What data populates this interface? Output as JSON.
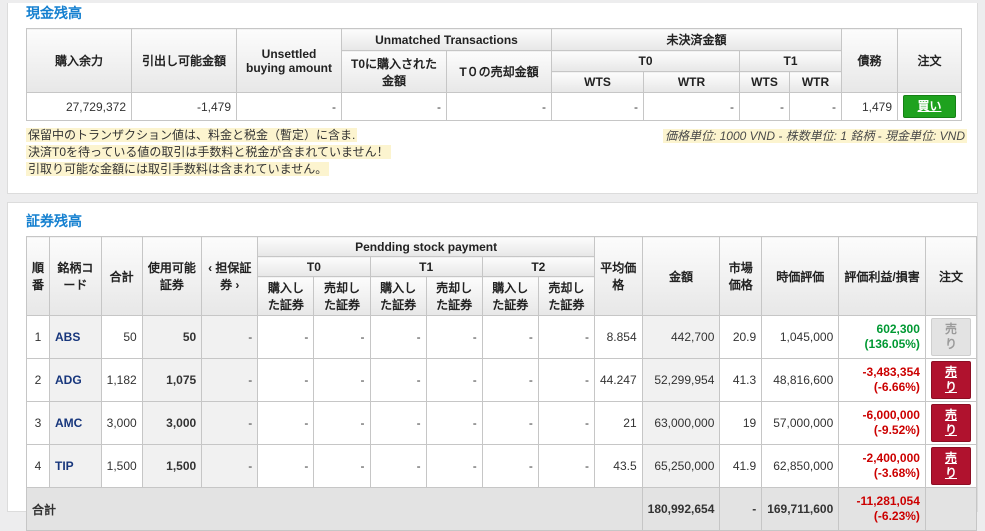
{
  "units_note": "価格単位: 1000 VND - 株数単位: 1 銘柄 - 現金単位: VND",
  "colors": {
    "accent_blue": "#1580d0",
    "buy_green": "#1ea21e",
    "sell_red": "#b0122e",
    "gain_green": "#009933",
    "loss_red": "#cc0000",
    "note_highlight": "#fcf4cf"
  },
  "cash": {
    "title": "現金残高",
    "headers": {
      "buying_power": "購入余力",
      "withdrawable": "引出し可能金額",
      "unsettled_buying": "Unsettled buying amount",
      "unmatched": "Unmatched Transactions",
      "t0_bought": "T0に購入された金額",
      "t0_sold": "T０の売却金額",
      "outstanding": "未決済金額",
      "t0": "T0",
      "t1": "T1",
      "wts": "WTS",
      "wtr": "WTR",
      "debt": "債務",
      "order": "注文"
    },
    "row": {
      "buying_power": "27,729,372",
      "withdrawable": "-1,479",
      "unsettled_buying": "-",
      "t0_bought": "-",
      "t0_sold": "-",
      "t0_wts": "-",
      "t0_wtr": "-",
      "t1_wts": "-",
      "t1_wtr": "-",
      "debt": "1,479",
      "buy_label": "買い"
    },
    "notes": [
      "保留中のトランザクション値は、料金と税金（暫定）に含ま.",
      "決済T0を待っている値の取引は手数料と税金が含まれていません！",
      "引取り可能な金額には取引手数料は含まれていません。"
    ]
  },
  "stock": {
    "title": "証券残高",
    "headers": {
      "no": "順番",
      "code": "銘柄コード",
      "total": "合計",
      "available": "使用可能証券",
      "collateral": "‹ 担保証券 ›",
      "pending": "Pendding stock payment",
      "t0": "T0",
      "t1": "T1",
      "t2": "T2",
      "bought": "購入した証券",
      "sold": "売却した証券",
      "avg_price": "平均価格",
      "amount": "金額",
      "market_price": "市場価格",
      "market_value": "時価評価",
      "pl": "評価利益/損害",
      "order": "注文"
    },
    "rows": [
      {
        "no": "1",
        "code": "ABS",
        "total": "50",
        "available": "50",
        "collateral": "-",
        "t0_bought": "-",
        "t0_sold": "-",
        "t1_bought": "-",
        "t1_sold": "-",
        "t2_bought": "-",
        "t2_sold": "-",
        "avg_price": "8.854",
        "amount": "442,700",
        "market_price": "20.9",
        "market_value": "1,045,000",
        "pl": "602,300",
        "pl_pct": "(136.05%)",
        "sell_label": "売り"
      },
      {
        "no": "2",
        "code": "ADG",
        "total": "1,182",
        "available": "1,075",
        "collateral": "-",
        "t0_bought": "-",
        "t0_sold": "-",
        "t1_bought": "-",
        "t1_sold": "-",
        "t2_bought": "-",
        "t2_sold": "-",
        "avg_price": "44.247",
        "amount": "52,299,954",
        "market_price": "41.3",
        "market_value": "48,816,600",
        "pl": "-3,483,354",
        "pl_pct": "(-6.66%)",
        "sell_label": "売り"
      },
      {
        "no": "3",
        "code": "AMC",
        "total": "3,000",
        "available": "3,000",
        "collateral": "-",
        "t0_bought": "-",
        "t0_sold": "-",
        "t1_bought": "-",
        "t1_sold": "-",
        "t2_bought": "-",
        "t2_sold": "-",
        "avg_price": "21",
        "amount": "63,000,000",
        "market_price": "19",
        "market_value": "57,000,000",
        "pl": "-6,000,000",
        "pl_pct": "(-9.52%)",
        "sell_label": "売り"
      },
      {
        "no": "4",
        "code": "TIP",
        "total": "1,500",
        "available": "1,500",
        "collateral": "-",
        "t0_bought": "-",
        "t0_sold": "-",
        "t1_bought": "-",
        "t1_sold": "-",
        "t2_bought": "-",
        "t2_sold": "-",
        "avg_price": "43.5",
        "amount": "65,250,000",
        "market_price": "41.9",
        "market_value": "62,850,000",
        "pl": "-2,400,000",
        "pl_pct": "(-3.68%)",
        "sell_label": "売り"
      }
    ],
    "total_row": {
      "label": "合計",
      "amount": "180,992,654",
      "market_price": "-",
      "market_value": "169,711,600",
      "pl": "-11,281,054",
      "pl_pct": "(-6.23%)"
    }
  }
}
